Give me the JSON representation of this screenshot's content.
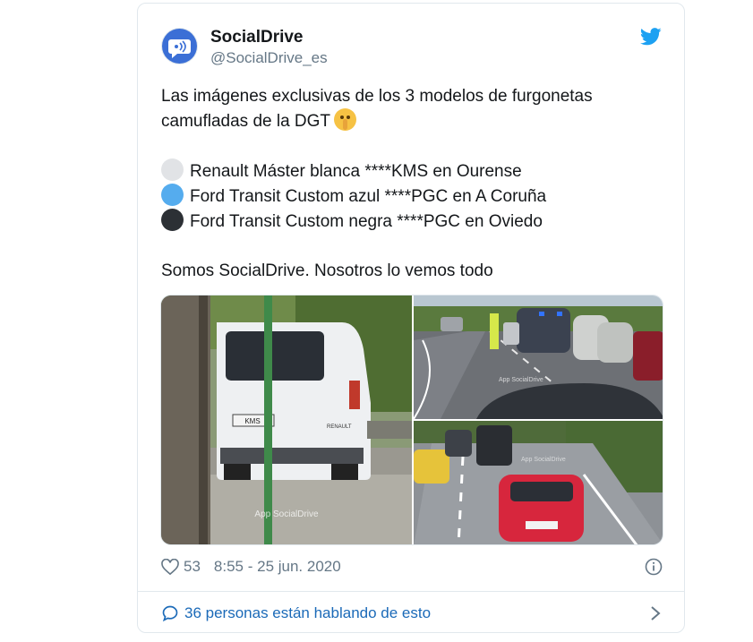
{
  "author": {
    "name": "SocialDrive",
    "handle": "@SocialDrive_es"
  },
  "tweet": {
    "line1": "Las imágenes exclusivas de los 3 modelos de furgonetas",
    "line2": "camufladas de la DGT",
    "emoji": "shushing-face-emoji",
    "items": [
      {
        "text": "Renault Máster blanca ****KMS en Ourense",
        "circle_color": "#e1e3e6"
      },
      {
        "text": "Ford Transit Custom azul ****PGC en A Coruña",
        "circle_color": "#55acee"
      },
      {
        "text": "Ford Transit Custom negra ****PGC en Oviedo",
        "circle_color": "#2c3035"
      }
    ],
    "closing": "Somos SocialDrive. Nosotros lo vemos todo"
  },
  "media": {
    "watermark": "App SocialDrive",
    "plate": "KMS",
    "van_badge": "RENAULT"
  },
  "meta": {
    "likes": "53",
    "timestamp": "8:55 - 25 jun. 2020"
  },
  "conversation": {
    "label": "36 personas están hablando de esto"
  },
  "icons": {
    "twitter": "twitter-bird-icon",
    "heart": "heart-icon",
    "info": "info-icon",
    "comment": "comment-icon",
    "chevron": "chevron-right-icon"
  },
  "colors": {
    "twitter_blue": "#1da1f2",
    "link_blue": "#1b6ab8",
    "secondary_text": "#657786"
  }
}
